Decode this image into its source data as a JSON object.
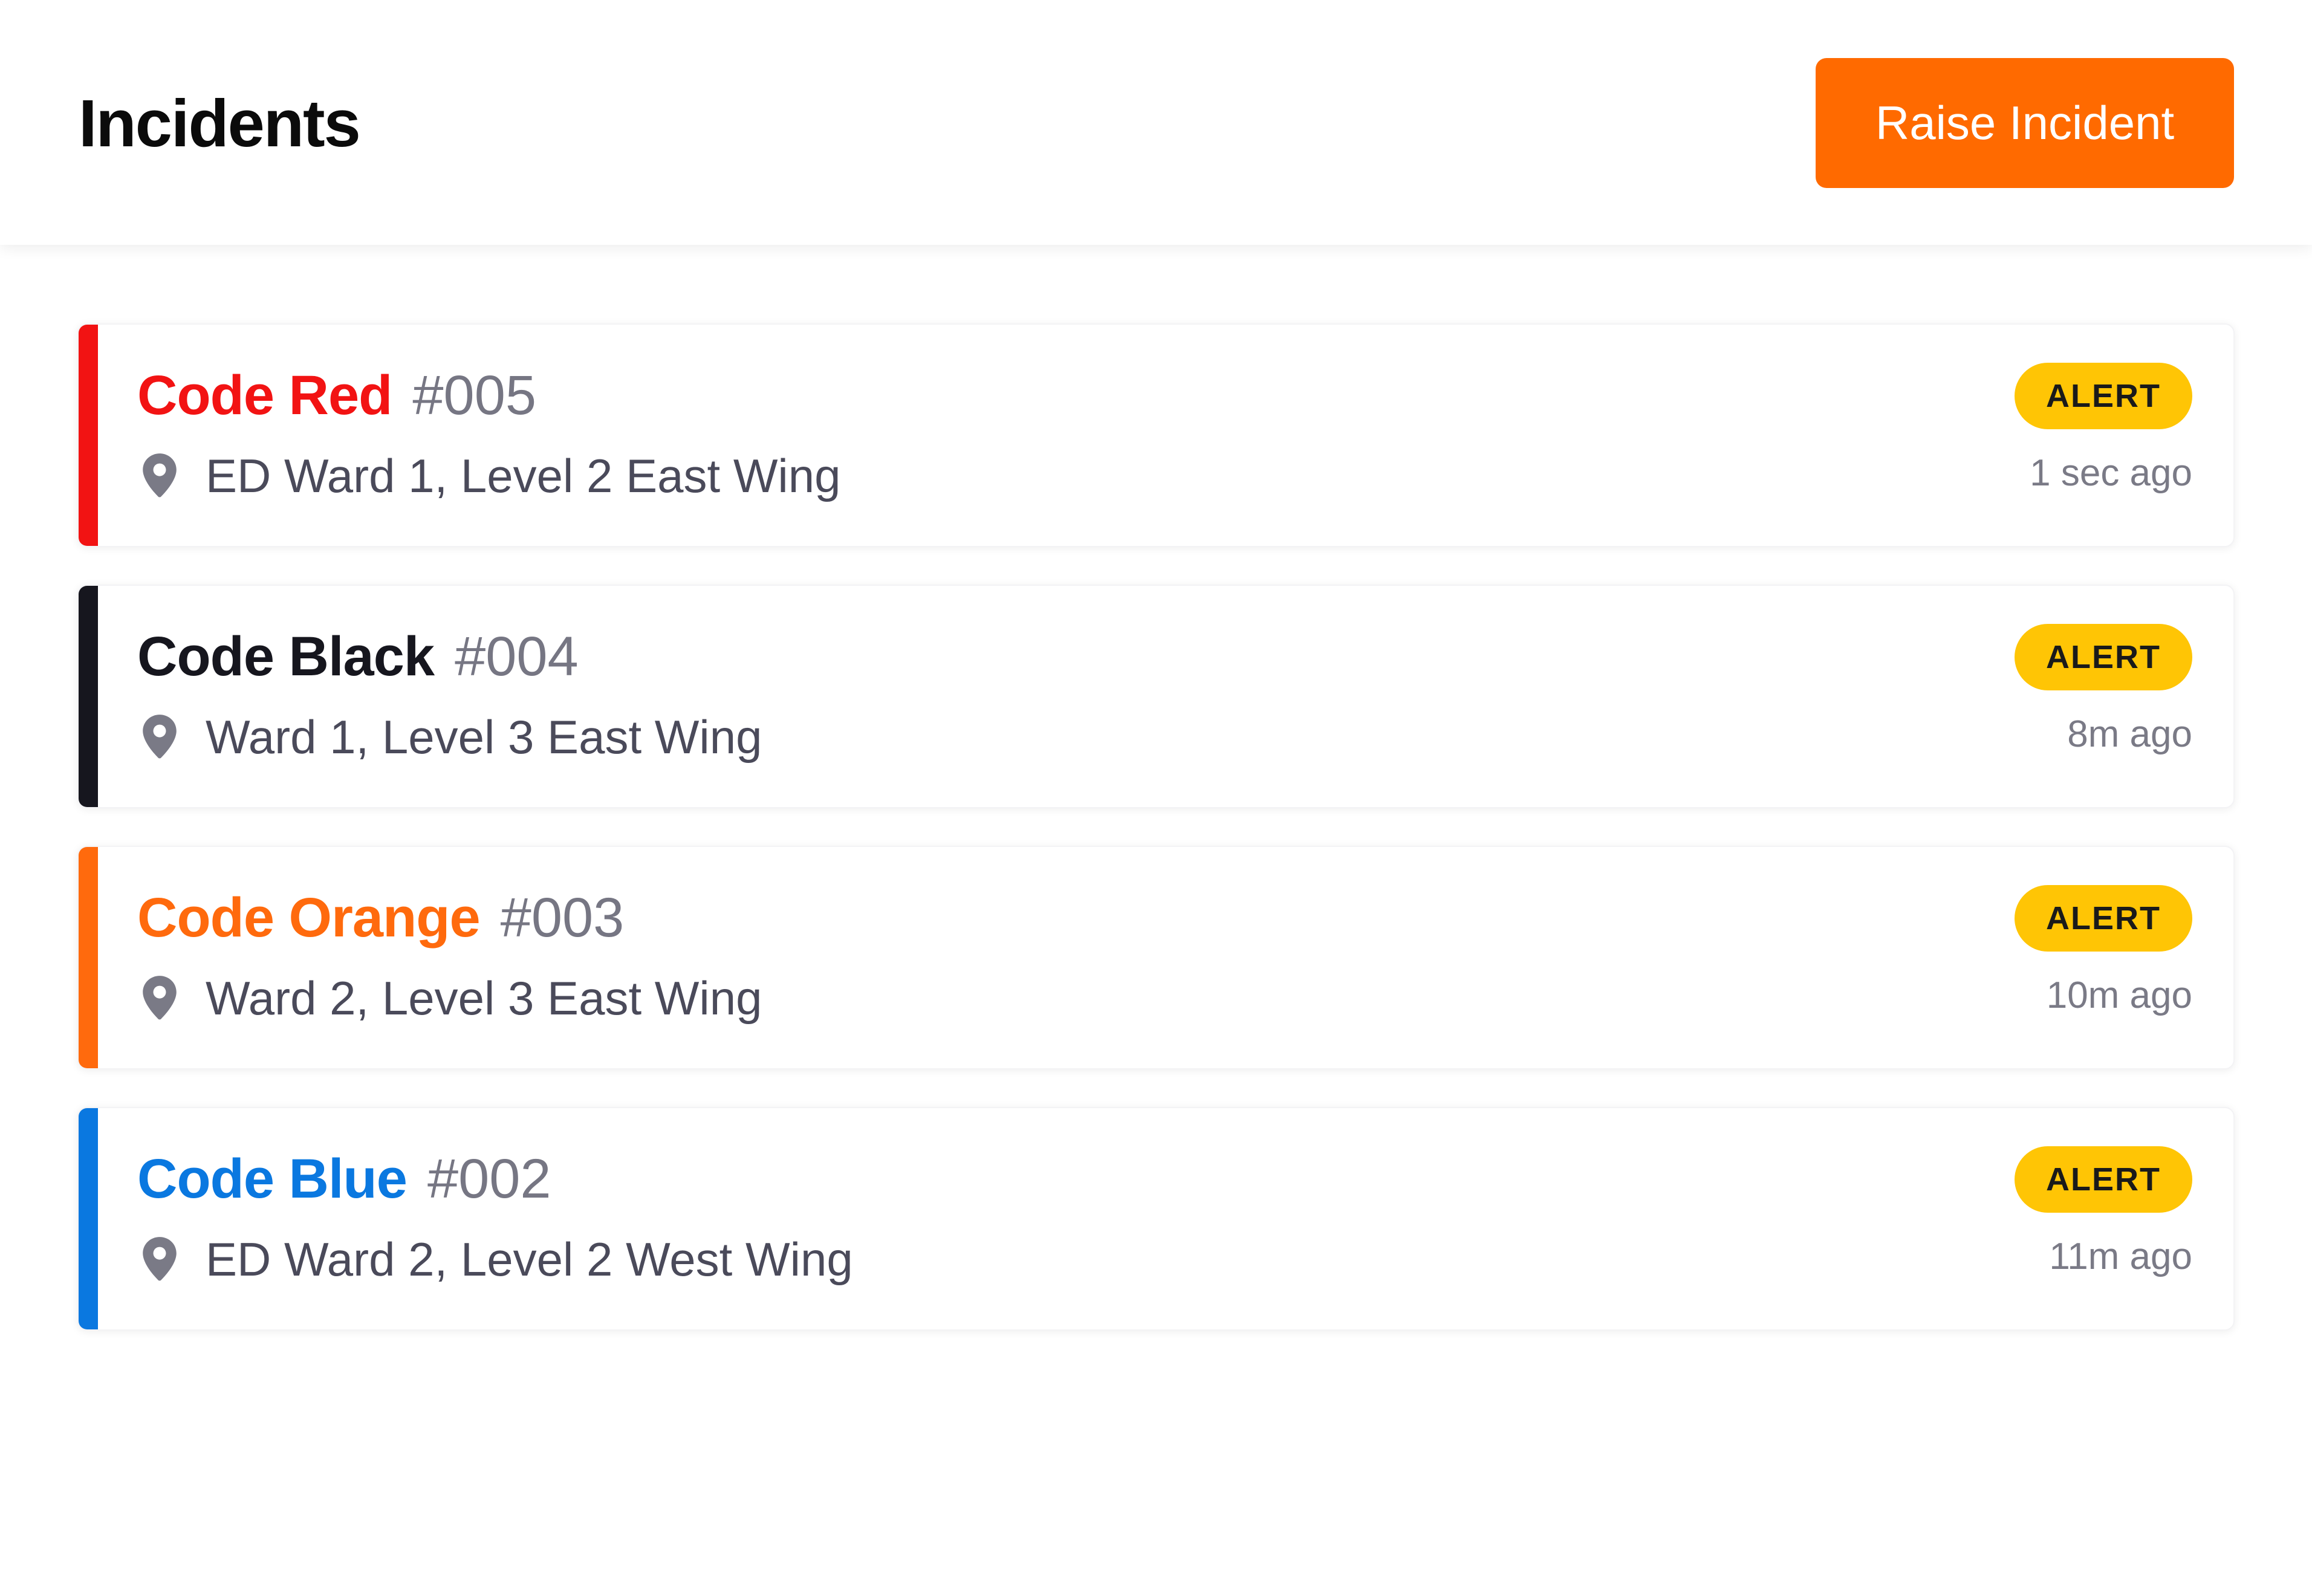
{
  "header": {
    "title": "Incidents",
    "raise_button_label": "Raise Incident"
  },
  "colors": {
    "accent": "#ff6a00",
    "badge": "#ffc505",
    "code_red": "#f21313",
    "code_black": "#16161e",
    "code_orange": "#ff6a0d",
    "code_blue": "#0a78e0"
  },
  "incidents": [
    {
      "code": "Code Red",
      "number": "#005",
      "location": "ED Ward 1, Level 2 East Wing",
      "status": "ALERT",
      "time": "1 sec ago",
      "color": "#f21313",
      "location_icon": "map-pin-icon"
    },
    {
      "code": "Code Black",
      "number": "#004",
      "location": "Ward 1, Level 3 East Wing",
      "status": "ALERT",
      "time": "8m ago",
      "color": "#16161e",
      "location_icon": "map-pin-icon"
    },
    {
      "code": "Code Orange",
      "number": "#003",
      "location": "Ward 2, Level 3 East Wing",
      "status": "ALERT",
      "time": "10m ago",
      "color": "#ff6a0d",
      "location_icon": "map-pin-icon"
    },
    {
      "code": "Code Blue",
      "number": "#002",
      "location": "ED Ward 2, Level 2 West Wing",
      "status": "ALERT",
      "time": "11m ago",
      "color": "#0a78e0",
      "location_icon": "map-pin-icon"
    }
  ]
}
